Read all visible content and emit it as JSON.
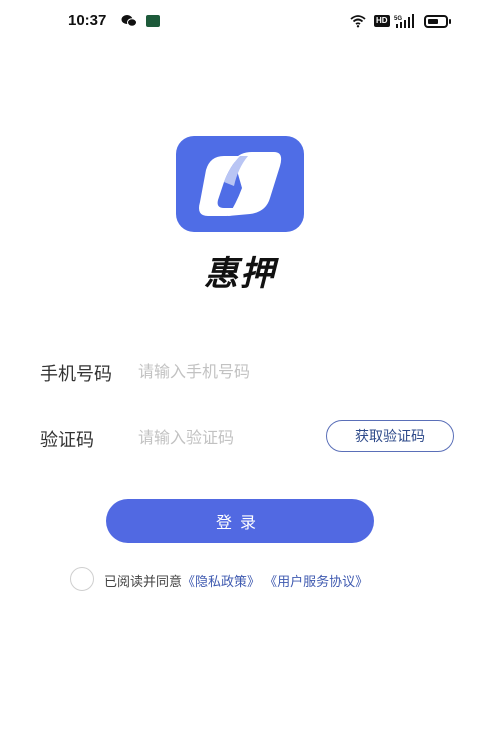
{
  "status_bar": {
    "time": "10:37",
    "icons": [
      "wechat-icon",
      "app-notification-icon",
      "wifi-icon",
      "hd-icon",
      "signal-5g-icon",
      "battery-icon"
    ],
    "hd_label": "HD",
    "battery_level": 0.6
  },
  "app": {
    "name": "惠押",
    "logo_color": "#4f6de6"
  },
  "form": {
    "phone": {
      "label": "手机号码",
      "placeholder": "请输入手机号码",
      "value": ""
    },
    "code": {
      "label": "验证码",
      "placeholder": "请输入验证码",
      "value": "",
      "button_label": "获取验证码"
    }
  },
  "login": {
    "label": "登录",
    "color": "#5169e2"
  },
  "agreement": {
    "prefix": "已阅读并同意",
    "privacy_link": "《隐私政策》",
    "terms_link": "《用户服务协议》",
    "checked": false,
    "link_color": "#3f5ab0"
  }
}
